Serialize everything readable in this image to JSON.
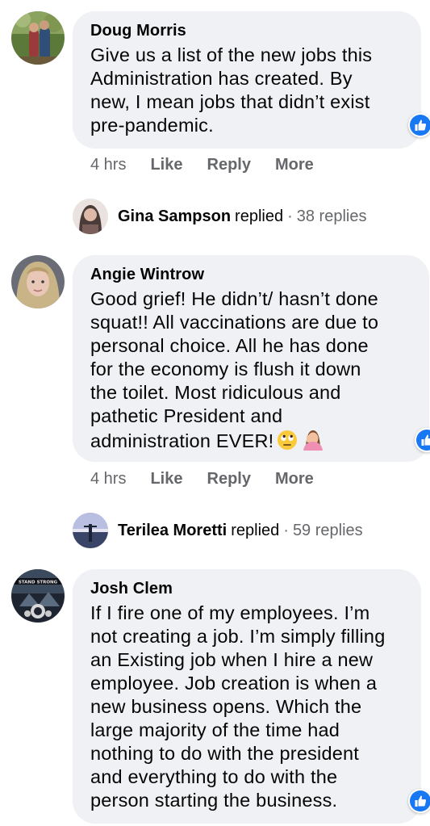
{
  "comments": [
    {
      "author": "Doug Morris",
      "text": "Give us a list of the new jobs this\nAdministration has created. By\nnew, I mean jobs that didn’t exist\npre-pandemic.",
      "time": "4 hrs",
      "like": "Like",
      "reply": "Reply",
      "more": "More",
      "replies": {
        "name": "Gina Sampson",
        "verb": "replied",
        "dot": "·",
        "count": "38 replies"
      }
    },
    {
      "author": "Angie Wintrow",
      "text": "Good grief! He didn’t/ hasn’t done\nsquat!! All vaccinations are due to\npersonal choice. All he has done\nfor the economy is flush it down\nthe toilet. Most ridiculous and\npathetic President and\nadministration EVER!",
      "emojis": [
        "face-with-rolling-eyes-emoji",
        "person-facepalming-emoji"
      ],
      "time": "4 hrs",
      "like": "Like",
      "reply": "Reply",
      "more": "More",
      "replies": {
        "name": "Terilea Moretti",
        "verb": "replied",
        "dot": "·",
        "count": "59 replies"
      }
    },
    {
      "author": "Josh Clem",
      "text": "If I fire one of my employees. I’m\nnot creating a job. I’m simply filling\nan Existing job when I hire a new\nemployee. Job creation is when a\nnew business opens. Which the\nlarge majority of the time had\nnothing to do with the president\nand everything to do with the\nperson starting the business.",
      "avatar_caption": "STAND STRONG"
    }
  ],
  "colors": {
    "bubble": "#eff1f4",
    "secondary_text": "#65676b",
    "like_blue": "#1877f2"
  },
  "icons": {
    "reaction": "like-thumb-icon"
  }
}
